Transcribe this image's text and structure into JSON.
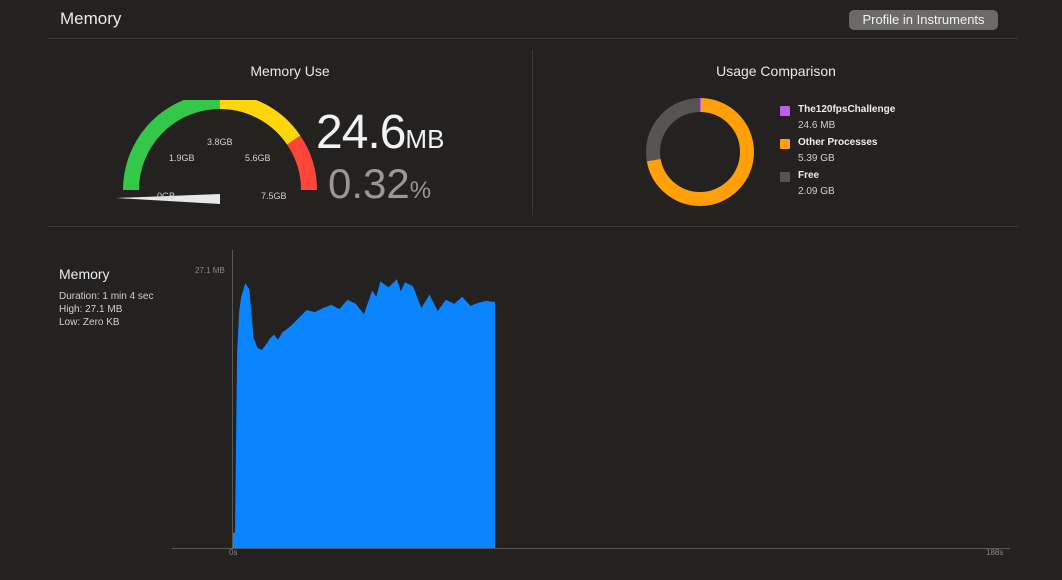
{
  "header": {
    "title": "Memory",
    "profile_button": "Profile in Instruments"
  },
  "memory_use": {
    "title": "Memory Use",
    "value": "24.6",
    "unit": "MB",
    "percent": "0.32",
    "percent_unit": "%",
    "gauge_labels": [
      "0GB",
      "1.9GB",
      "3.8GB",
      "5.6GB",
      "7.5GB"
    ],
    "gauge_level": 0.0032,
    "colors": {
      "green": "#34c84a",
      "yellow": "#ffd60a",
      "red": "#ff453a"
    }
  },
  "usage_comparison": {
    "title": "Usage Comparison",
    "legend": [
      {
        "name": "The120fpsChallenge",
        "value": "24.6 MB",
        "color": "#bf5af2"
      },
      {
        "name": "Other Processes",
        "value": "5.39 GB",
        "color": "#ff9f0a"
      },
      {
        "name": "Free",
        "value": "2.09 GB",
        "color": "#555452"
      }
    ]
  },
  "timeline": {
    "title": "Memory",
    "duration": "Duration: 1 min 4 sec",
    "high": "High: 27.1 MB",
    "low": "Low: Zero KB",
    "y_max_label": "27.1 MB",
    "x_start_label": "0s",
    "x_end_label": "188s",
    "fill_color": "#0a84ff"
  },
  "chart_data": [
    {
      "type": "pie",
      "title": "Usage Comparison",
      "categories": [
        "The120fpsChallenge",
        "Other Processes",
        "Free"
      ],
      "values": [
        0.0246,
        5.39,
        2.09
      ],
      "unit": "GB"
    },
    {
      "type": "area",
      "title": "Memory",
      "xlabel": "",
      "ylabel": "",
      "xlim": [
        0,
        188
      ],
      "ylim": [
        0,
        27.1
      ],
      "x": [
        0,
        0.5,
        1,
        1.5,
        2,
        3,
        4,
        5,
        6,
        7,
        8,
        9,
        10,
        11,
        12,
        14,
        16,
        18,
        20,
        22,
        24,
        26,
        28,
        30,
        32,
        34,
        35,
        36,
        38,
        40,
        41,
        42,
        44,
        46,
        48,
        50,
        52,
        54,
        56,
        58,
        60,
        62,
        63,
        64
      ],
      "y": [
        1.5,
        1.5,
        19,
        23,
        24.5,
        25.8,
        25.2,
        20.5,
        19.5,
        19.3,
        19.8,
        20.4,
        20.8,
        20.3,
        21.0,
        21.6,
        22.4,
        23.2,
        23.0,
        23.4,
        23.7,
        23.3,
        24.2,
        23.8,
        22.8,
        25.1,
        24.5,
        26.0,
        25.4,
        26.2,
        25.0,
        25.9,
        25.5,
        23.4,
        24.7,
        23.1,
        24.2,
        23.8,
        24.5,
        23.6,
        23.9,
        24.1,
        24.0,
        24.0
      ]
    }
  ]
}
